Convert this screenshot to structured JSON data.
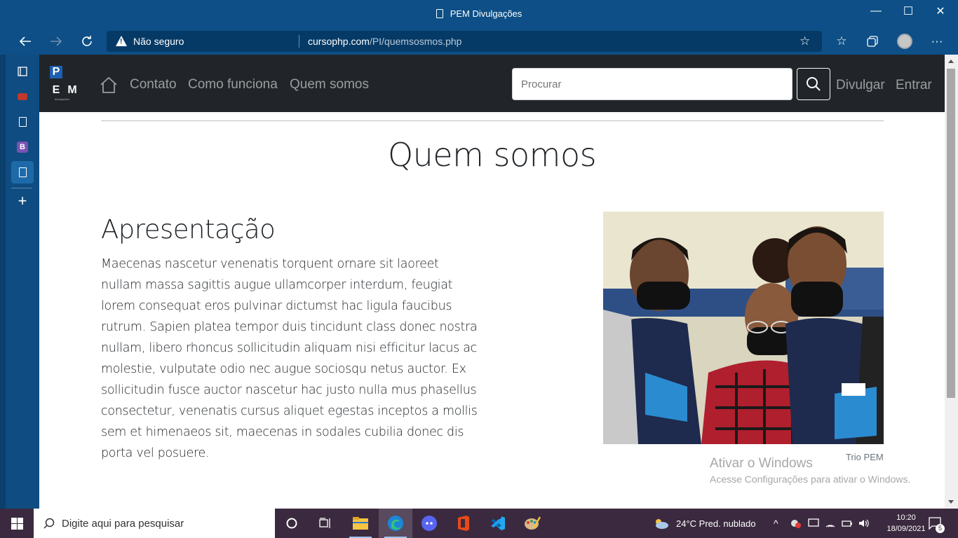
{
  "window": {
    "title": "PEM Divulgações",
    "minimize": "—",
    "maximize": "☐",
    "close": "✕"
  },
  "browser": {
    "security_label": "Não seguro",
    "url_host": "cursophp.com",
    "url_path": "/PI/quemsosmos.php"
  },
  "site": {
    "logo_letters": [
      "P",
      "E",
      "M"
    ],
    "logo_tagline": "divulgações",
    "nav_links": [
      "Contato",
      "Como funciona",
      "Quem somos"
    ],
    "search_placeholder": "Procurar",
    "right_links": [
      "Divulgar",
      "Entrar"
    ]
  },
  "content": {
    "title": "Quem somos",
    "section_title": "Apresentação",
    "paragraph": "Maecenas nascetur venenatis torquent ornare sit laoreet nullam massa sagittis augue ullamcorper interdum, feugiat lorem consequat eros pulvinar dictumst hac ligula faucibus rutrum. Sapien platea tempor duis tincidunt class donec nostra nullam, libero rhoncus sollicitudin aliquam nisi efficitur lacus ac molestie, vulputate odio nec augue sociosqu netus auctor. Ex sollicitudin fusce auctor nascetur hac justo nulla mus phasellus consectetur, venenatis cursus aliquet egestas inceptos a mollis sem et himenaeos sit, maecenas in sodales cubilia donec dis porta vel posuere.",
    "photo_caption": "Trio PEM"
  },
  "watermark": {
    "line1": "Ativar o Windows",
    "line2": "Acesse Configurações para ativar o Windows."
  },
  "taskbar": {
    "search_placeholder": "Digite aqui para pesquisar",
    "weather": "24°C  Pred. nublado",
    "time": "10:20",
    "date": "18/09/2021",
    "notification_count": "5"
  }
}
